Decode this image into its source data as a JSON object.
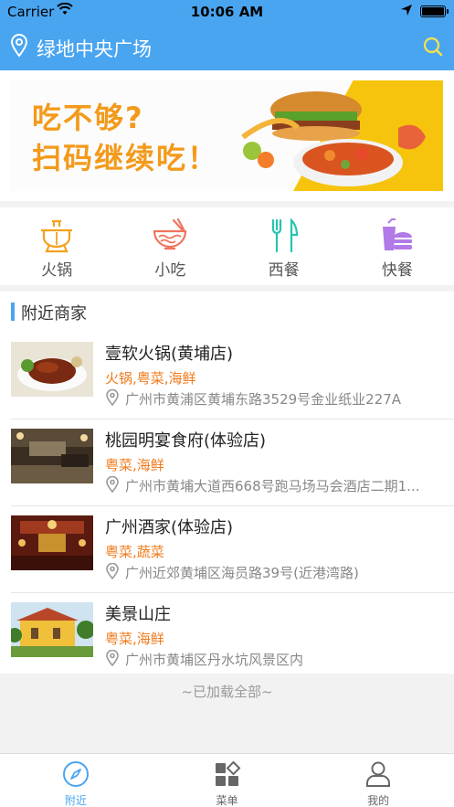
{
  "status_bar": {
    "carrier": "Carrier",
    "time": "10:06 AM"
  },
  "header": {
    "location": "绿地中央广场"
  },
  "banner": {
    "line1": "吃不够?",
    "line2": "扫码继续吃！"
  },
  "categories": [
    {
      "label": "火锅",
      "icon": "hotpot-icon",
      "color": "#f3a21f"
    },
    {
      "label": "小吃",
      "icon": "noodle-bowl-icon",
      "color": "#f0745c"
    },
    {
      "label": "西餐",
      "icon": "fork-knife-icon",
      "color": "#27c3b0"
    },
    {
      "label": "快餐",
      "icon": "burger-drink-icon",
      "color": "#b27ae8"
    }
  ],
  "section": {
    "title": "附近商家"
  },
  "merchants": [
    {
      "name": "壹软火锅(黄埔店)",
      "tags": "火锅,粤菜,海鲜",
      "address": "广州市黄浦区黄埔东路3529号金业纸业227A"
    },
    {
      "name": "桃园明宴食府(体验店)",
      "tags": "粤菜,海鲜",
      "address": "广州市黄埔大道西668号跑马场马会酒店二期1..."
    },
    {
      "name": "广州酒家(体验店)",
      "tags": "粤菜,蔬菜",
      "address": "广州近郊黄埔区海员路39号(近港湾路)"
    },
    {
      "name": "美景山庄",
      "tags": "粤菜,海鲜",
      "address": "广州市黄埔区丹水坑风景区内"
    }
  ],
  "footer": {
    "loaded_all": "~已加载全部~"
  },
  "tabs": [
    {
      "label": "附近",
      "icon": "compass-icon",
      "active": true
    },
    {
      "label": "菜单",
      "icon": "menu-grid-icon",
      "active": false
    },
    {
      "label": "我的",
      "icon": "user-icon",
      "active": false
    }
  ],
  "colors": {
    "primary": "#4aa5f0",
    "tag": "#f07a1a",
    "banner_text": "#f39a1b"
  }
}
